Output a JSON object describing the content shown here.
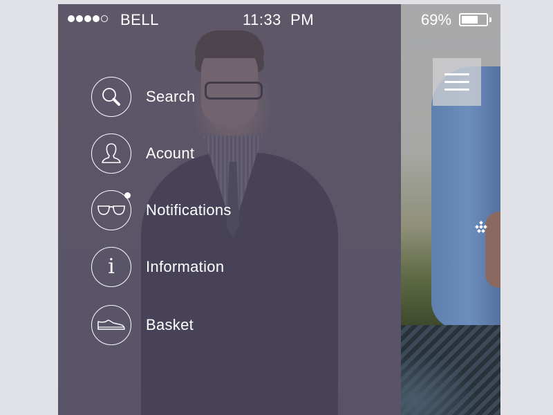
{
  "status_bar": {
    "signal_bars_filled": 4,
    "signal_bars_total": 5,
    "carrier": "BELL",
    "time": "11:33  PM",
    "battery_percent": "69%",
    "battery_level": 0.69
  },
  "menu": {
    "items": [
      {
        "label": "Search",
        "icon": "search-icon"
      },
      {
        "label": "Acount",
        "icon": "user-icon"
      },
      {
        "label": "Notifications",
        "icon": "glasses-icon",
        "has_badge": true
      },
      {
        "label": "Information",
        "icon": "info-icon"
      },
      {
        "label": "Basket",
        "icon": "shoe-icon"
      }
    ]
  },
  "header": {
    "menu_button_icon": "hamburger-icon"
  },
  "colors": {
    "page_background": "#e1e2e8",
    "overlay": "#5c5668",
    "text": "#ffffff",
    "menu_button_bg": "#d2d2d4"
  }
}
